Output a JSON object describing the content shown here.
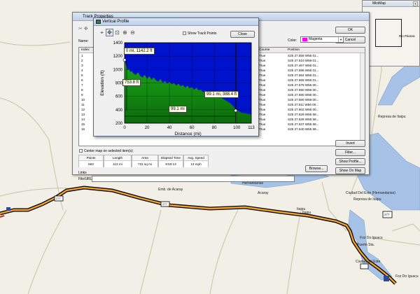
{
  "map": {
    "labels": [
      "Emb. de Acaray",
      "Hernandarias",
      "Acaray",
      "Itaipu",
      "Puerto Sta.",
      "Represa de Itaipu",
      "Ciudad Del Este (Hernandarias)",
      "Represa de Itaipu",
      "Ciudad del Este",
      "Foz Do Iguacu",
      "Foz Do Iguacu",
      "Itaipu"
    ],
    "route_badge": "277",
    "route_badge_2": "277",
    "shield_left": "277"
  },
  "minimap": {
    "title": "MiniMap",
    "close": "x",
    "label": "Rio Parana"
  },
  "track_properties": {
    "title": "Track Properties",
    "name_label": "Name:",
    "color_label": "Color:",
    "color_value": "Magenta",
    "ok": "OK",
    "cancel": "Cancel",
    "columns": [
      "Index",
      "Course",
      "Position"
    ],
    "rows": [
      {
        "index": "1",
        "course": "True",
        "position": "S25 27.559 W56 01..."
      },
      {
        "index": "2",
        "course": "True",
        "position": "S25 27.510 W56 01..."
      },
      {
        "index": "3",
        "course": "True",
        "position": "S25 27.467 W56 01..."
      },
      {
        "index": "4",
        "course": "True",
        "position": "S25 27.596 W56 01..."
      },
      {
        "index": "5",
        "course": "True",
        "position": "S25 27.564 W56 01..."
      },
      {
        "index": "6",
        "course": "True",
        "position": "S25 27.569 W56 01..."
      },
      {
        "index": "7",
        "course": "True",
        "position": "S25 27.578 W56 00..."
      },
      {
        "index": "8",
        "course": "True",
        "position": "S25 27.590 W56 00..."
      },
      {
        "index": "9",
        "course": "True",
        "position": "S25 27.580 W56 00..."
      },
      {
        "index": "10",
        "course": "True",
        "position": "S25 27.580 W56 00..."
      },
      {
        "index": "11",
        "course": "True",
        "position": "S25 27.611 W56 00..."
      },
      {
        "index": "12",
        "course": "True",
        "position": "S25 27.602 W56 00..."
      },
      {
        "index": "13",
        "course": "True",
        "position": "S25 27.629 W55 59..."
      },
      {
        "index": "14",
        "course": "True",
        "position": "S25 27.628 W55 59..."
      },
      {
        "index": "15",
        "course": "True",
        "position": "S25 27.637 W55 59..."
      },
      {
        "index": "16",
        "course": "True",
        "position": "S25 27.640 W55 59..."
      }
    ],
    "center_map_label": "Center map on selected item(s)",
    "stats": [
      {
        "label": "Points",
        "value": "663"
      },
      {
        "label": "Length",
        "value": "113 mi"
      },
      {
        "label": "Area",
        "value": "731 sq mi"
      },
      {
        "label": "Elapsed Time",
        "value": "8:50:13"
      },
      {
        "label": "Avg. Speed",
        "value": "13 mph"
      }
    ],
    "invert": "Invert",
    "filter": "Filter...",
    "show_profile": "Show Profile...",
    "show_on_map": "Show On Map",
    "links_label": "Links",
    "file_url_label": "File/URL:",
    "browse": "Browse..."
  },
  "vertical_profile": {
    "title": "Vertical Profile",
    "show_track_points": "Show Track Points",
    "close": "Close",
    "tags": {
      "start": "0 mi, 1142.2 ft",
      "drop": "753.8 ft",
      "end": "99.1 mi, 388.4 ft",
      "distance": "99.1 mi"
    }
  },
  "chart_data": {
    "type": "area",
    "title": "",
    "xlabel": "Distance (mi)",
    "ylabel": "Elevation (ft)",
    "xlim": [
      0,
      113
    ],
    "ylim": [
      200,
      1400
    ],
    "x_ticks": [
      0,
      20,
      40,
      60,
      80,
      100,
      113
    ],
    "y_ticks": [
      200,
      400,
      600,
      800,
      1000,
      1200,
      1400
    ],
    "grid": true,
    "colors": {
      "fill": "#1aa81a",
      "fill_dark": "#0b6b0b",
      "sky": "#0012cc",
      "line": "#000000"
    },
    "x": [
      0,
      1,
      2,
      3,
      4,
      5,
      6,
      8,
      10,
      12,
      14,
      16,
      18,
      20,
      22,
      24,
      26,
      28,
      30,
      32,
      34,
      36,
      38,
      40,
      42,
      44,
      46,
      48,
      50,
      52,
      54,
      56,
      58,
      60,
      62,
      64,
      66,
      68,
      70,
      72,
      74,
      76,
      78,
      80,
      82,
      84,
      86,
      88,
      90,
      92,
      94,
      96,
      98,
      99.1,
      101,
      104,
      107,
      110,
      113
    ],
    "y": [
      1142,
      1080,
      1020,
      990,
      1010,
      960,
      980,
      940,
      920,
      960,
      900,
      880,
      920,
      860,
      900,
      850,
      880,
      840,
      820,
      860,
      800,
      830,
      790,
      820,
      780,
      800,
      760,
      790,
      750,
      770,
      730,
      760,
      720,
      740,
      700,
      730,
      690,
      700,
      660,
      690,
      640,
      660,
      620,
      630,
      600,
      610,
      580,
      560,
      540,
      520,
      500,
      470,
      430,
      388,
      390,
      360,
      350,
      340,
      330
    ],
    "markers": [
      {
        "x": 0,
        "y": 1142.2
      },
      {
        "x": 99.1,
        "y": 388.4
      }
    ]
  }
}
